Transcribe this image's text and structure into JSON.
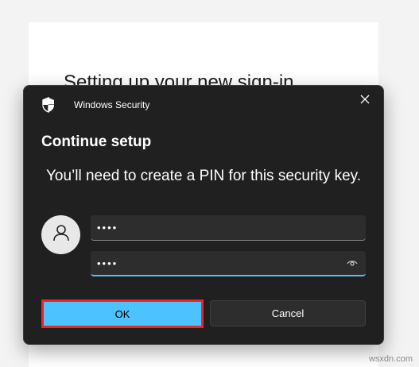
{
  "background": {
    "heading": "Setting up your new sign-in"
  },
  "dialog": {
    "title": "Windows Security",
    "heading": "Continue setup",
    "message": "You’ll need to create a PIN for this security key.",
    "pin_field": {
      "value": "••••",
      "state": "filled"
    },
    "confirm_pin_field": {
      "value": "••••",
      "state": "focused"
    },
    "ok_label": "OK",
    "cancel_label": "Cancel"
  },
  "icons": {
    "title_icon": "shield-icon",
    "close": "close-icon",
    "avatar": "person-icon",
    "reveal": "eye-icon"
  },
  "colors": {
    "dialog_bg": "#202020",
    "accent": "#4cc2ff",
    "highlight_border": "#e8262a"
  },
  "watermark": "wsxdn.com"
}
